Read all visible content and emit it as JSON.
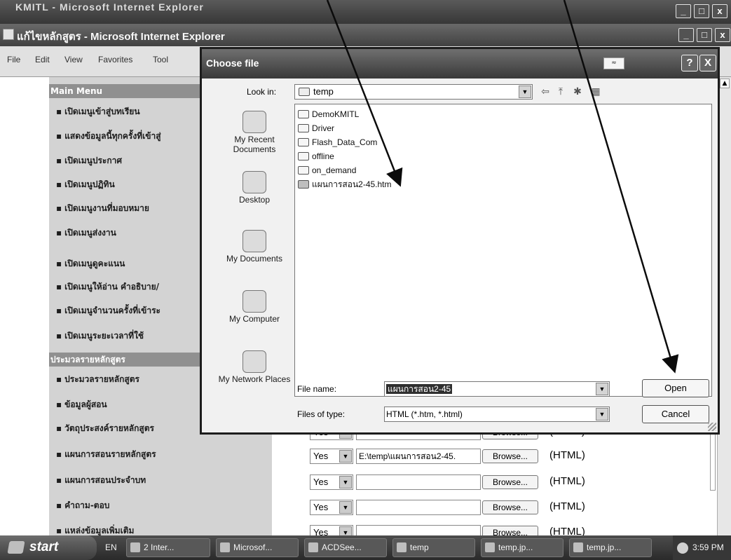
{
  "outer_window": {
    "title": "KMITL - Microsoft Internet Explorer"
  },
  "browser": {
    "title": "แก้ไขหลักสูตร - Microsoft Internet Explorer",
    "menu": [
      "File",
      "Edit",
      "View",
      "Favorites",
      "Tool"
    ]
  },
  "sidebar": {
    "main_header": "Main Menu",
    "main_items": [
      "เปิดเมนูเข้าสู่บทเรียน",
      "แสดงข้อมูลนี้ทุกครั้งที่เข้าสู่",
      "เปิดเมนูประกาศ",
      "เปิดเมนูปฏิทิน",
      "เปิดเมนูงานที่มอบหมาย",
      "เปิดเมนูส่งงาน",
      "เปิดเมนูดูคะแนน",
      "เปิดเมนูให้อ่าน คำอธิบาย/",
      "เปิดเมนูจำนวนครั้งที่เข้าระ",
      "เปิดเมนูระยะเวลาที่ใช้"
    ],
    "course_header": "ประมวลรายหลักสูตร",
    "course_items": [
      "ประมวลรายหลักสูตร",
      "ข้อมูลผู้สอน",
      "วัตถุประสงค์รายหลักสูตร",
      "แผนการสอนรายหลักสูตร",
      "แผนการสอนประจำบท",
      "คำถาม-ตอบ",
      "แหล่งข้อมูลเพิ่มเติม"
    ]
  },
  "form_rows": [
    {
      "yes": "Yes",
      "path": "",
      "browse": "Browse...",
      "format": "(HTML)"
    },
    {
      "yes": "Yes",
      "path": "E:\\temp\\แผนการสอน2-45.",
      "browse": "Browse...",
      "format": "(HTML)"
    },
    {
      "yes": "Yes",
      "path": "",
      "browse": "Browse...",
      "format": "(HTML)"
    },
    {
      "yes": "Yes",
      "path": "",
      "browse": "Browse...",
      "format": "(HTML)"
    },
    {
      "yes": "Yes",
      "path": "",
      "browse": "Browse...",
      "format": "(HTML)"
    }
  ],
  "dialog": {
    "title": "Choose file",
    "help_button": "?",
    "close_button": "X",
    "look_in_label": "Look in:",
    "look_in_value": "temp",
    "places": [
      "My Recent Documents",
      "Desktop",
      "My Documents",
      "My Computer",
      "My Network Places"
    ],
    "files": [
      {
        "name": "DemoKMITL",
        "type": "folder"
      },
      {
        "name": "Driver",
        "type": "folder"
      },
      {
        "name": "Flash_Data_Com",
        "type": "folder"
      },
      {
        "name": "offline",
        "type": "folder"
      },
      {
        "name": "on_demand",
        "type": "folder"
      },
      {
        "name": "แผนการสอน2-45.htm",
        "type": "html"
      }
    ],
    "file_name_label": "File name:",
    "file_name_value": "แผนการสอน2-45",
    "files_of_type_label": "Files of type:",
    "files_of_type_value": "HTML (*.htm, *.html)",
    "open_button": "Open",
    "cancel_button": "Cancel"
  },
  "taskbar": {
    "start": "start",
    "language": "EN",
    "tasks": [
      "2 Inter...",
      "Microsof...",
      "ACDSee...",
      "temp",
      "temp.jp...",
      "temp.jp..."
    ],
    "clock": "3:59 PM"
  }
}
